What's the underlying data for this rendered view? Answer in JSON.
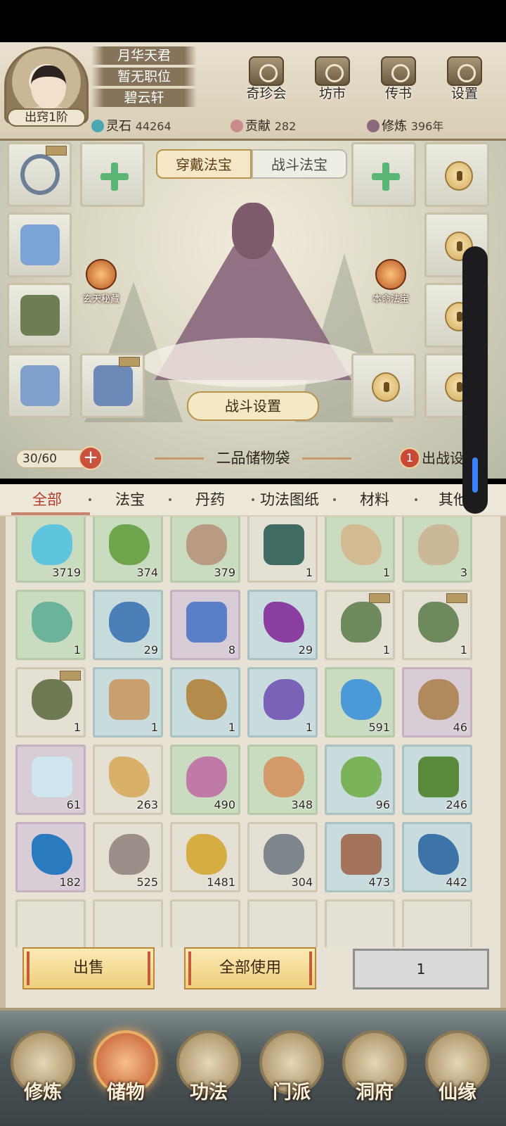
{
  "header": {
    "name": "月华天君",
    "position": "暂无职位",
    "sect": "碧云轩",
    "rank": "出窍1阶",
    "resources": [
      {
        "label": "灵石",
        "value": "44264",
        "color": "#4ca6b0"
      },
      {
        "label": "贡献",
        "value": "282",
        "color": "#c98a8a"
      },
      {
        "label": "修炼",
        "value": "396年",
        "color": "#8a6a7a"
      }
    ],
    "buttons": [
      {
        "label": "奇珍会",
        "icon": "pavilion-icon"
      },
      {
        "label": "坊市",
        "icon": "market-icon"
      },
      {
        "label": "传书",
        "icon": "scroll-icon"
      },
      {
        "label": "设置",
        "icon": "gear-icon"
      }
    ]
  },
  "equip": {
    "tabs": [
      "穿戴法宝",
      "战斗法宝"
    ],
    "feature_left": "玄天秘藏",
    "feature_right": "本命法宝",
    "battle_settings": "战斗设置"
  },
  "bag": {
    "capacity": "30/60",
    "title": "二品储物袋",
    "deploy_badge": "1",
    "deploy_label": "出战设置"
  },
  "categories": [
    "全部",
    "法宝",
    "丹药",
    "功法图纸",
    "材料",
    "其他"
  ],
  "items": [
    {
      "name": "spirit-crystal",
      "count": "3719",
      "rarity": "green",
      "tint": "#5fc4dd"
    },
    {
      "name": "green-herb",
      "count": "374",
      "rarity": "green",
      "tint": "#6fa54c"
    },
    {
      "name": "raw-ore",
      "count": "379",
      "rarity": "green",
      "tint": "#b89b82"
    },
    {
      "name": "bronze-cauldron",
      "count": "1",
      "rarity": "white",
      "tint": "#3f6b62"
    },
    {
      "name": "recipe-scroll",
      "count": "1",
      "rarity": "green",
      "tint": "#d2bb90"
    },
    {
      "name": "old-paper",
      "count": "3",
      "rarity": "green",
      "tint": "#cbb897"
    },
    {
      "name": "jade-vase",
      "count": "1",
      "rarity": "green",
      "tint": "#6bb39a"
    },
    {
      "name": "blue-orchid",
      "count": "29",
      "rarity": "blue",
      "tint": "#4a7fb8"
    },
    {
      "name": "violet-orchid",
      "count": "8",
      "rarity": "purple",
      "tint": "#5a7fc8"
    },
    {
      "name": "purple-lily",
      "count": "29",
      "rarity": "blue",
      "tint": "#8a3fa0"
    },
    {
      "name": "green-robe",
      "count": "1",
      "rarity": "white",
      "tint": "#6d8a5d",
      "tag": true
    },
    {
      "name": "green-robe-2",
      "count": "1",
      "rarity": "white",
      "tint": "#6d8a5d",
      "tag": true
    },
    {
      "name": "green-boots",
      "count": "1",
      "rarity": "white",
      "tint": "#6d7a52",
      "tag": true
    },
    {
      "name": "claw-glove",
      "count": "1",
      "rarity": "blue",
      "tint": "#c7a06d"
    },
    {
      "name": "coiled-rope",
      "count": "1",
      "rarity": "blue",
      "tint": "#b38b4a"
    },
    {
      "name": "spear",
      "count": "1",
      "rarity": "blue",
      "tint": "#7a62b8"
    },
    {
      "name": "water-drop",
      "count": "591",
      "rarity": "green",
      "tint": "#4a9ad8"
    },
    {
      "name": "wood-token",
      "count": "46",
      "rarity": "purple",
      "tint": "#b08a5c"
    },
    {
      "name": "ice-crystal",
      "count": "61",
      "rarity": "purple",
      "tint": "#cfe6ee"
    },
    {
      "name": "ginseng",
      "count": "263",
      "rarity": "white",
      "tint": "#d8b06a"
    },
    {
      "name": "pink-root",
      "count": "490",
      "rarity": "green",
      "tint": "#c07aa8"
    },
    {
      "name": "orange-root",
      "count": "348",
      "rarity": "green",
      "tint": "#d39a6a"
    },
    {
      "name": "white-flower",
      "count": "96",
      "rarity": "blue",
      "tint": "#7ab35a"
    },
    {
      "name": "red-berry-branch",
      "count": "246",
      "rarity": "blue",
      "tint": "#5a8a3a"
    },
    {
      "name": "orb-branch",
      "count": "182",
      "rarity": "purple",
      "tint": "#2a7ac0"
    },
    {
      "name": "grey-stone",
      "count": "525",
      "rarity": "white",
      "tint": "#9c8e88"
    },
    {
      "name": "gold-ore",
      "count": "1481",
      "rarity": "white",
      "tint": "#d6ad42"
    },
    {
      "name": "iron-ore",
      "count": "304",
      "rarity": "white",
      "tint": "#7d858d"
    },
    {
      "name": "copper-ore",
      "count": "473",
      "rarity": "blue",
      "tint": "#a2725a"
    },
    {
      "name": "blue-ore",
      "count": "442",
      "rarity": "blue",
      "tint": "#3c74a8"
    }
  ],
  "actions": {
    "sell": "出售",
    "use_all": "全部使用",
    "quantity": "1"
  },
  "nav": [
    {
      "label": "修炼",
      "active": false
    },
    {
      "label": "储物",
      "active": true
    },
    {
      "label": "功法",
      "active": false
    },
    {
      "label": "门派",
      "active": false
    },
    {
      "label": "洞府",
      "active": false
    },
    {
      "label": "仙缘",
      "active": false
    }
  ]
}
